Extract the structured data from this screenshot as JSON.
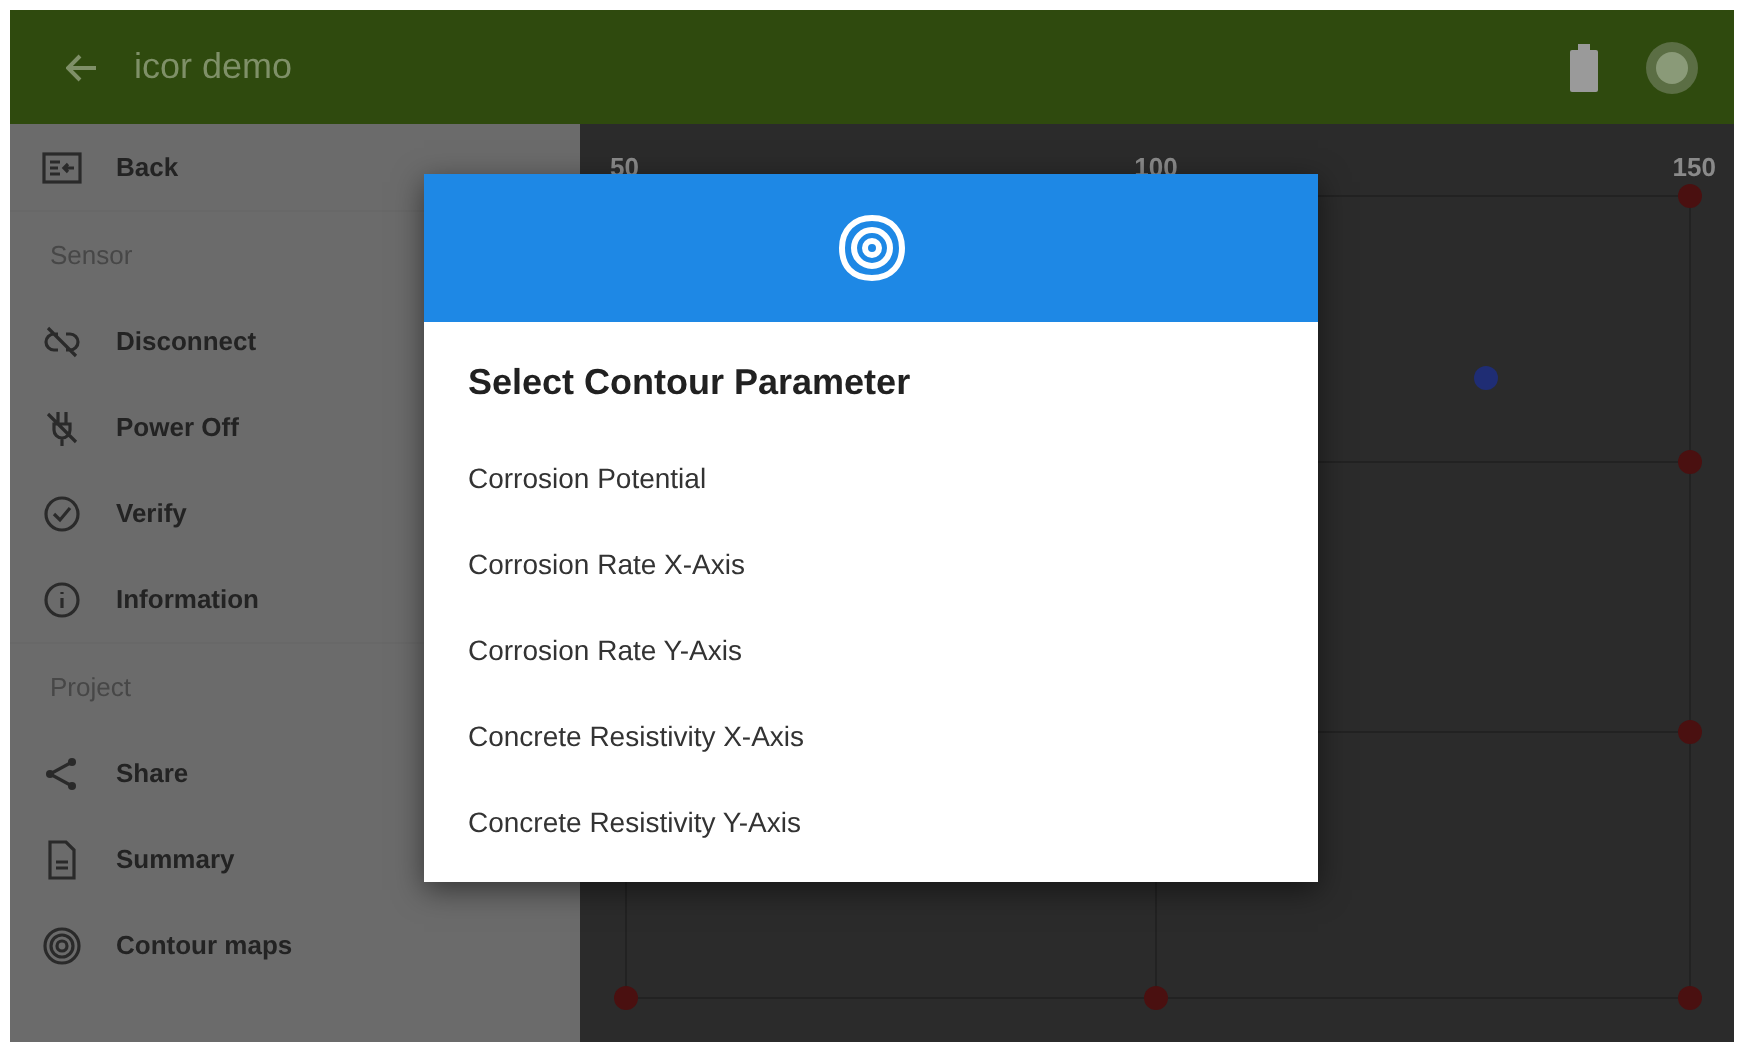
{
  "app_bar": {
    "title": "icor demo"
  },
  "sidebar": {
    "items": [
      {
        "kind": "item",
        "label": "Back"
      },
      {
        "kind": "divider"
      },
      {
        "kind": "header",
        "label": "Sensor"
      },
      {
        "kind": "item",
        "label": "Disconnect"
      },
      {
        "kind": "item",
        "label": "Power Off"
      },
      {
        "kind": "item",
        "label": "Verify"
      },
      {
        "kind": "item",
        "label": "Information"
      },
      {
        "kind": "divider"
      },
      {
        "kind": "header",
        "label": "Project"
      },
      {
        "kind": "item",
        "label": "Share"
      },
      {
        "kind": "item",
        "label": "Summary"
      },
      {
        "kind": "item",
        "label": "Contour maps"
      }
    ]
  },
  "grid_canvas": {
    "x_labels": [
      "50",
      "100",
      "150"
    ]
  },
  "dialog": {
    "title": "Select Contour Parameter",
    "options": [
      "Corrosion Potential",
      "Corrosion Rate X-Axis",
      "Corrosion Rate Y-Axis",
      "Concrete Resistivity X-Axis",
      "Concrete Resistivity Y-Axis"
    ]
  }
}
